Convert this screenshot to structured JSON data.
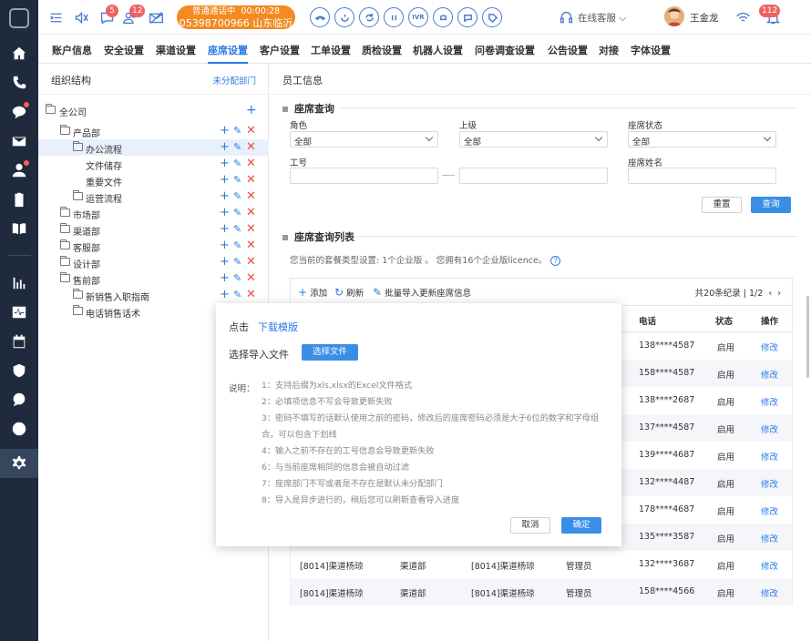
{
  "topbar": {
    "badges": {
      "notify": "5",
      "people": "12",
      "alarm": "112"
    },
    "call": {
      "state": "普通通话中",
      "timer": "00:00:28",
      "number": "05398700966",
      "location": "山东临沂"
    },
    "ivr_label": "IVR",
    "status": "在线客服",
    "user": "王金龙"
  },
  "menu": [
    "账户信息",
    "安全设置",
    "渠道设置",
    "座席设置",
    "客户设置",
    "工单设置",
    "质检设置",
    "机器人设置",
    "问卷调查设置",
    "公告设置",
    "对接",
    "字体设置"
  ],
  "menu_active": "座席设置",
  "org": {
    "title": "组织结构",
    "unassigned": "未分配部门",
    "nodes": [
      {
        "label": "全公司",
        "level": 0
      },
      {
        "label": "产品部",
        "level": 1
      },
      {
        "label": "办公流程",
        "level": 2
      },
      {
        "label": "文件储存",
        "level": 3
      },
      {
        "label": "重要文件",
        "level": 3
      },
      {
        "label": "运营流程",
        "level": 2
      },
      {
        "label": "市场部",
        "level": 1
      },
      {
        "label": "渠道部",
        "level": 1
      },
      {
        "label": "客服部",
        "level": 1
      },
      {
        "label": "设计部",
        "level": 1
      },
      {
        "label": "售前部",
        "level": 1
      },
      {
        "label": "新销售入职指南",
        "level": 2
      },
      {
        "label": "电话销售话术",
        "level": 2
      }
    ]
  },
  "staff": {
    "title": "员工信息",
    "query_title": "座席查询",
    "fields": {
      "role_label": "角色",
      "role_value": "全部",
      "parent_label": "上级",
      "parent_value": "全部",
      "status_label": "座席状态",
      "status_value": "全部",
      "id_label": "工号",
      "name_label": "座席姓名"
    },
    "reset": "重置",
    "search": "查询",
    "list_title": "座席查询列表",
    "note": "您当前的套餐类型设置: 1个企业版 。 您拥有16个企业版licence。",
    "toolbar": {
      "add": "添加",
      "refresh": "刷新",
      "import": "批量导入更新座席信息",
      "total": "共20条纪录 | 1/2"
    },
    "columns": {
      "phone": "电话",
      "status": "状态",
      "op": "操作"
    },
    "rows": [
      {
        "phone": "138****4587",
        "status": "启用",
        "op": "修改"
      },
      {
        "phone": "158****4587",
        "status": "启用",
        "op": "修改"
      },
      {
        "phone": "138****2687",
        "status": "启用",
        "op": "修改"
      },
      {
        "phone": "137****4587",
        "status": "启用",
        "op": "修改"
      },
      {
        "phone": "139****4687",
        "status": "启用",
        "op": "修改"
      },
      {
        "phone": "132****4487",
        "status": "启用",
        "op": "修改"
      },
      {
        "phone": "178****4687",
        "status": "启用",
        "op": "修改"
      },
      {
        "phone": "135****3587",
        "status": "启用",
        "op": "修改"
      },
      {
        "name": "[8014]渠道杨琼",
        "dept": "渠道部",
        "parent": "[8014]渠道杨琼",
        "role": "管理员",
        "phone": "132****3687",
        "status": "启用",
        "op": "修改"
      },
      {
        "name": "[8014]渠道杨琼",
        "dept": "渠道部",
        "parent": "[8014]渠道杨琼",
        "role": "管理员",
        "phone": "158****4566",
        "status": "启用",
        "op": "修改"
      }
    ]
  },
  "modal": {
    "click": "点击",
    "download": "下载模版",
    "choose_label": "选择导入文件",
    "choose_button": "选择文件",
    "explain_label": "说明：",
    "lines": [
      "1：支持后缀为xls,xlsx的Excel文件格式",
      "2：必填项信息不写会导致更新失败",
      "3：密码不填写的话默认使用之前的密码，修改后的座席密码必须是大于6位的数字和字母组合，可以包含下划线",
      "4：输入之前不存在的工号信息会导致更新失败",
      "6：与当前座席相同的信息会被自动过滤",
      "7：座席部门不写或者是不存在是默认未分配部门",
      "8：导入是异步进行的，稍后您可以刷新查看导入进度"
    ],
    "cancel": "取消",
    "ok": "确定"
  }
}
